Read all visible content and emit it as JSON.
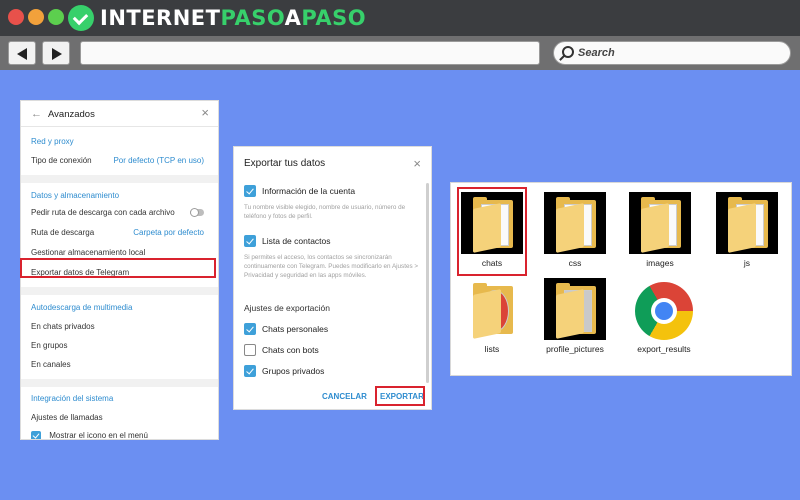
{
  "browser": {
    "logo_text_1": "INTERNET",
    "logo_text_2": "PASO",
    "logo_text_3": "A",
    "logo_text_4": "PASO",
    "search_placeholder": "Search"
  },
  "avanzados": {
    "title": "Avanzados",
    "sections": {
      "red_proxy": "Red y proxy",
      "tipo_conexion": "Tipo de conexión",
      "tipo_conexion_value": "Por defecto (TCP en uso)",
      "datos_almacenamiento": "Datos y almacenamiento",
      "pedir_ruta": "Pedir ruta de descarga con cada archivo",
      "ruta_descarga": "Ruta de descarga",
      "ruta_descarga_value": "Carpeta por defecto",
      "gestionar": "Gestionar almacenamiento local",
      "exportar": "Exportar datos de Telegram",
      "autodescarga": "Autodescarga de multimedia",
      "chats_privados": "En chats privados",
      "grupos": "En grupos",
      "canales": "En canales",
      "integracion": "Integración del sistema",
      "ajustes_llamadas": "Ajustes de llamadas",
      "mostrar_icono": "Mostrar el icono en el menú"
    }
  },
  "exportar": {
    "title": "Exportar tus datos",
    "info_cuenta": "Información de la cuenta",
    "info_cuenta_desc": "Tu nombre visible elegido, nombre de usuario, número de teléfono y fotos de perfil.",
    "lista_contactos": "Lista de contactos",
    "lista_contactos_desc": "Si permites el acceso, los contactos se sincronizarán continuamente con Telegram. Puedes modificarlo en Ajustes > Privacidad y seguridad en las apps móviles.",
    "ajustes_exportacion": "Ajustes de exportación",
    "chats_personales": "Chats personales",
    "chats_bots": "Chats con bots",
    "grupos_privados": "Grupos privados",
    "cancel": "CANCELAR",
    "export": "EXPORTAR"
  },
  "folders": [
    {
      "name": "chats"
    },
    {
      "name": "css"
    },
    {
      "name": "images"
    },
    {
      "name": "js"
    },
    {
      "name": "lists"
    },
    {
      "name": "profile_pictures"
    },
    {
      "name": "export_results"
    }
  ],
  "colors": {
    "background": "#6b8ff2",
    "accent": "#2e8ccf",
    "highlight": "#d9232e"
  }
}
